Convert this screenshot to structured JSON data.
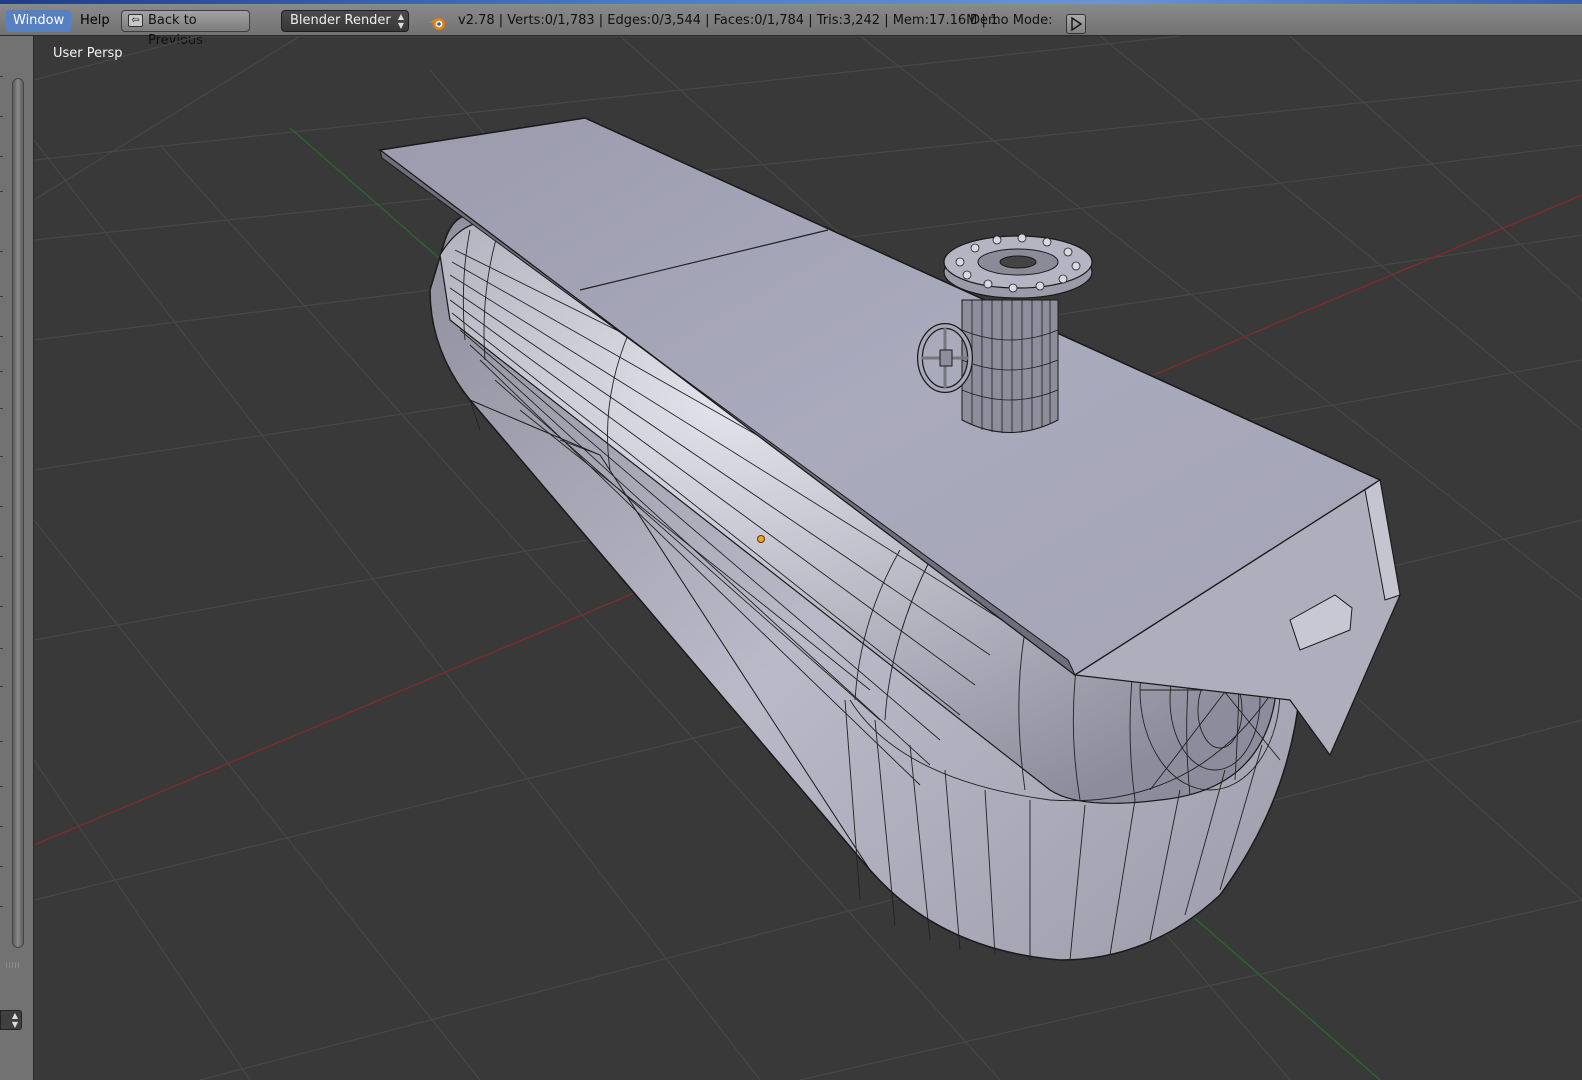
{
  "menubar": {
    "window_label": "Window",
    "help_label": "Help",
    "back_button_label": "Back to Previous",
    "render_engine": "Blender Render",
    "stats": "v2.78 | Verts:0/1,783 | Edges:0/3,544 | Faces:0/1,784 | Tris:3,242 | Mem:17.16M | 1",
    "demo_mode_label": "Demo Mode:"
  },
  "viewport": {
    "view_label": "User Persp"
  },
  "colors": {
    "menu_active": "#5680c2",
    "viewport_bg": "#393939",
    "grid_line": "#464646",
    "x_axis": "#8b2a2a",
    "y_axis": "#2e6b2e",
    "mesh_fill": "#b2b2c4",
    "wire": "#1a1a1a",
    "origin": "#f0a030"
  },
  "icons": {
    "back": "back-arrow-icon",
    "blender": "blender-logo-icon",
    "play": "play-icon"
  }
}
